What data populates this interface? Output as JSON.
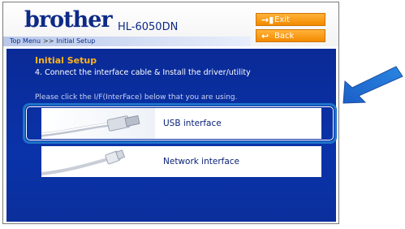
{
  "header": {
    "logo": "brother",
    "model": "HL-6050DN",
    "breadcrumb": {
      "home": "Top Menu",
      "separator": ">>",
      "current": "Initial Setup"
    },
    "buttons": {
      "exit": "Exit",
      "back": "Back"
    }
  },
  "content": {
    "section_title": "Initial Setup",
    "step": "4. Connect the interface cable & Install the driver/utility",
    "instruction": "Please click the I/F(InterFace) below that you are using.",
    "options": [
      {
        "label": "USB interface"
      },
      {
        "label": "Network interface"
      }
    ]
  },
  "colors": {
    "brand": "#0d2a86",
    "accent": "#f28a00",
    "content_bg": "#0a2fa0",
    "highlight": "#1f73c9"
  }
}
